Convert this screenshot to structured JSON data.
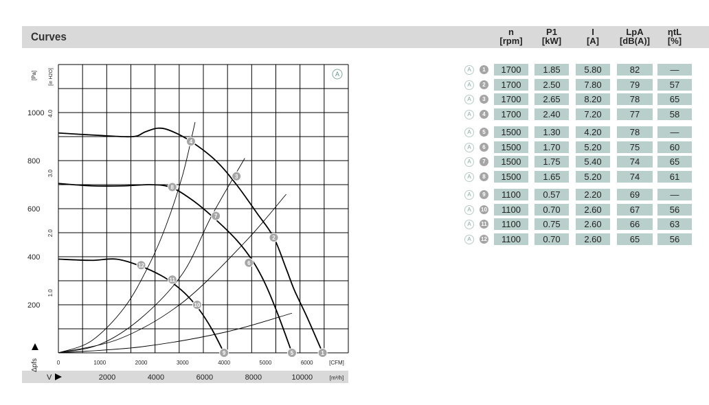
{
  "section_title": "Curves",
  "curve_tag": "A",
  "table": {
    "columns": [
      {
        "name": "n",
        "unit": "[rpm]"
      },
      {
        "name": "P1",
        "unit": "[kW]"
      },
      {
        "name": "I",
        "unit": "[A]"
      },
      {
        "name": "LpA",
        "unit": "[dB(A)]"
      },
      {
        "name": "ηtL",
        "unit": "[%]"
      }
    ],
    "groups": [
      [
        {
          "id": "1",
          "values": [
            "1700",
            "1.85",
            "5.80",
            "82",
            "—"
          ]
        },
        {
          "id": "2",
          "values": [
            "1700",
            "2.50",
            "7.80",
            "79",
            "57"
          ]
        },
        {
          "id": "3",
          "values": [
            "1700",
            "2.65",
            "8.20",
            "78",
            "65"
          ]
        },
        {
          "id": "4",
          "values": [
            "1700",
            "2.40",
            "7.20",
            "77",
            "58"
          ]
        }
      ],
      [
        {
          "id": "5",
          "values": [
            "1500",
            "1.30",
            "4.20",
            "78",
            "—"
          ]
        },
        {
          "id": "6",
          "values": [
            "1500",
            "1.70",
            "5.20",
            "75",
            "60"
          ]
        },
        {
          "id": "7",
          "values": [
            "1500",
            "1.75",
            "5.40",
            "74",
            "65"
          ]
        },
        {
          "id": "8",
          "values": [
            "1500",
            "1.65",
            "5.20",
            "74",
            "61"
          ]
        }
      ],
      [
        {
          "id": "9",
          "values": [
            "1100",
            "0.57",
            "2.20",
            "69",
            "—"
          ]
        },
        {
          "id": "10",
          "values": [
            "1100",
            "0.70",
            "2.60",
            "67",
            "56"
          ]
        },
        {
          "id": "11",
          "values": [
            "1100",
            "0.75",
            "2.60",
            "66",
            "63"
          ]
        },
        {
          "id": "12",
          "values": [
            "1100",
            "0.70",
            "2.60",
            "65",
            "56"
          ]
        }
      ]
    ]
  },
  "chart_data": {
    "type": "line",
    "ylabel": "Δpfs",
    "ylabel_left": "[Pa]",
    "ylabel_right": "[in H2O]",
    "xlabel_top_unit": "[CFM]",
    "xlabel_bottom_unit": "[m³/h]",
    "xlabel_bottom": "V",
    "x_ticks_cfm": [
      "0",
      "1000",
      "2000",
      "3000",
      "4000",
      "5000",
      "6000"
    ],
    "x_ticks_m3h": [
      "2000",
      "4000",
      "6000",
      "8000",
      "10000"
    ],
    "y_ticks_pa": [
      "200",
      "400",
      "600",
      "800",
      "1000"
    ],
    "y_ticks_inh2o": [
      "1.0",
      "2.0",
      "3.0",
      "4.0"
    ],
    "xlim_cfm": [
      0,
      7000
    ],
    "ylim_pa": [
      0,
      1200
    ],
    "series": [
      {
        "name": "1700",
        "x": [
          0,
          1000,
          1800,
          2100,
          2400,
          2700,
          3200,
          3800,
          4300,
          4800,
          5200,
          5500,
          5700,
          6000,
          6380
        ],
        "y": [
          915,
          905,
          900,
          920,
          935,
          925,
          880,
          800,
          700,
          580,
          480,
          350,
          260,
          150,
          0
        ]
      },
      {
        "name": "1500",
        "x": [
          0,
          800,
          1600,
          2200,
          2700,
          3200,
          3700,
          4300,
          4700,
          5000,
          5300,
          5640
        ],
        "y": [
          705,
          695,
          695,
          700,
          690,
          640,
          570,
          470,
          380,
          285,
          160,
          0
        ]
      },
      {
        "name": "1100",
        "x": [
          0,
          800,
          1400,
          2000,
          2500,
          2800,
          3100,
          3400,
          3700,
          4000
        ],
        "y": [
          390,
          385,
          390,
          360,
          320,
          285,
          240,
          180,
          100,
          0
        ]
      }
    ],
    "system_lines": [
      {
        "name": "12",
        "x": [
          0,
          800,
          1600,
          2200,
          2600,
          3000,
          3300
        ],
        "y": [
          0,
          50,
          190,
          370,
          530,
          740,
          960
        ]
      },
      {
        "name": "7",
        "x": [
          0,
          1000,
          2000,
          3000,
          3700,
          4500
        ],
        "y": [
          0,
          35,
          145,
          330,
          570,
          810
        ]
      },
      {
        "name": "10",
        "x": [
          0,
          1500,
          3000,
          4500,
          5500
        ],
        "y": [
          0,
          60,
          210,
          460,
          660
        ]
      },
      {
        "name": "low",
        "x": [
          0,
          2000,
          4000,
          5640
        ],
        "y": [
          0,
          25,
          85,
          165
        ]
      }
    ],
    "markers": [
      {
        "id": "1",
        "x": 6380,
        "y": 0
      },
      {
        "id": "2",
        "x": 5200,
        "y": 480
      },
      {
        "id": "3",
        "x": 4300,
        "y": 735
      },
      {
        "id": "4",
        "x": 3200,
        "y": 880
      },
      {
        "id": "5",
        "x": 5640,
        "y": 0
      },
      {
        "id": "6",
        "x": 4600,
        "y": 375
      },
      {
        "id": "7",
        "x": 3800,
        "y": 570
      },
      {
        "id": "8",
        "x": 2750,
        "y": 690
      },
      {
        "id": "9",
        "x": 4000,
        "y": 0
      },
      {
        "id": "10",
        "x": 3350,
        "y": 200
      },
      {
        "id": "11",
        "x": 2750,
        "y": 305
      },
      {
        "id": "12",
        "x": 2000,
        "y": 365
      }
    ]
  }
}
